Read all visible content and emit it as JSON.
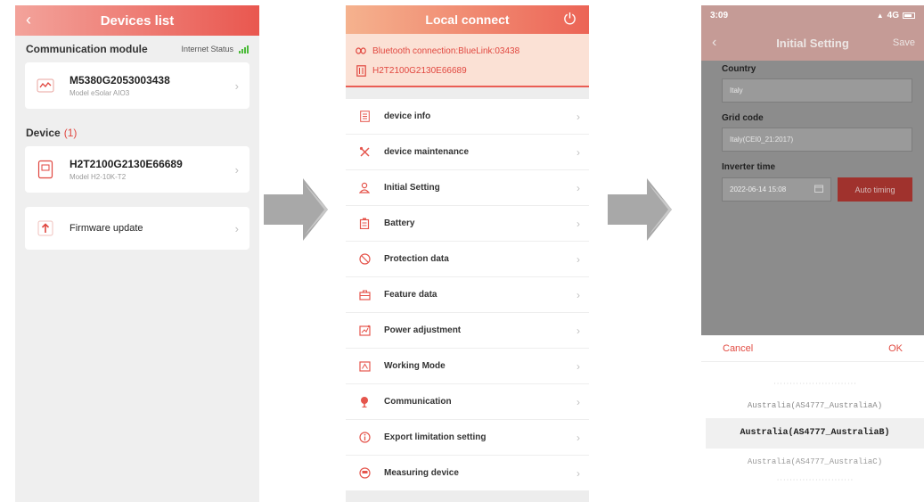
{
  "screen1": {
    "title": "Devices list",
    "back_icon": "chevron-left-icon",
    "communication_module_label": "Communication module",
    "internet_status_label": "Internet Status",
    "module": {
      "serial": "M5380G2053003438",
      "model": "Model eSolar AIO3"
    },
    "device_label": "Device",
    "device_count": "(1)",
    "device": {
      "serial": "H2T2100G2130E66689",
      "model": "Model H2-10K-T2"
    },
    "firmware_label": "Firmware update",
    "accent": "#e9574f",
    "signal_color": "#4cbb3a"
  },
  "screen2": {
    "title": "Local connect",
    "bluetooth_text": "Bluetooth connection:BlueLink:03438",
    "device_serial": "H2T2100G2130E66689",
    "menu": [
      {
        "label": "device info",
        "icon": "document-icon"
      },
      {
        "label": "device maintenance",
        "icon": "tools-icon"
      },
      {
        "label": "Initial Setting",
        "icon": "person-icon"
      },
      {
        "label": "Battery",
        "icon": "battery-icon"
      },
      {
        "label": "Protection data",
        "icon": "shield-icon"
      },
      {
        "label": "Feature data",
        "icon": "briefcase-icon"
      },
      {
        "label": "Power adjustment",
        "icon": "power-adjust-icon"
      },
      {
        "label": "Working Mode",
        "icon": "mode-icon"
      },
      {
        "label": "Communication",
        "icon": "antenna-icon"
      },
      {
        "label": "Export limitation setting",
        "icon": "info-icon"
      },
      {
        "label": "Measuring device",
        "icon": "meter-icon"
      }
    ]
  },
  "screen3": {
    "time": "3:09",
    "status_right": "4G",
    "title": "Initial Setting",
    "save_label": "Save",
    "country_label": "Country",
    "country_value": "Italy",
    "grid_code_label": "Grid code",
    "grid_code_value": "Italy(CEI0_21:2017)",
    "inverter_time_label": "Inverter time",
    "inverter_time_value": "2022-06-14 15:08",
    "auto_timing_label": "Auto timing",
    "cancel_label": "Cancel",
    "ok_label": "OK",
    "options": [
      "Australia(AS4777_AustraliaA)",
      "Australia(AS4777_AustraliaB)",
      "Australia(AS4777_AustraliaC)"
    ]
  }
}
